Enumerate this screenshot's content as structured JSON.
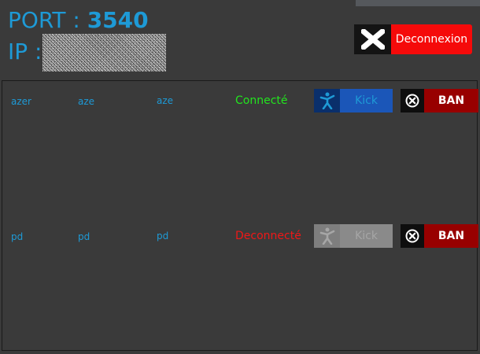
{
  "header": {
    "port_label": "PORT : ",
    "port_value": "3540",
    "ip_label": "IP :"
  },
  "toolbar": {
    "logout_label": "Deconnexion",
    "logout_icon": "close-x-icon"
  },
  "players": [
    {
      "col1": "azer",
      "col2": "aze",
      "col3": "aze",
      "status": "Connecté",
      "status_color": "#22e51e",
      "kick_label": "Kick",
      "kick_enabled": true,
      "ban_label": "BAN"
    },
    {
      "col1": "pd",
      "col2": "pd",
      "col3": "pd",
      "status": "Deconnecté",
      "status_color": "#f01717",
      "kick_label": "Kick",
      "kick_enabled": false,
      "ban_label": "BAN"
    }
  ],
  "colors": {
    "accent": "#1e9ad6",
    "background": "#3a3a3a",
    "danger": "#f50a0a",
    "ban": "#980000",
    "kick": "#1b56b8"
  }
}
